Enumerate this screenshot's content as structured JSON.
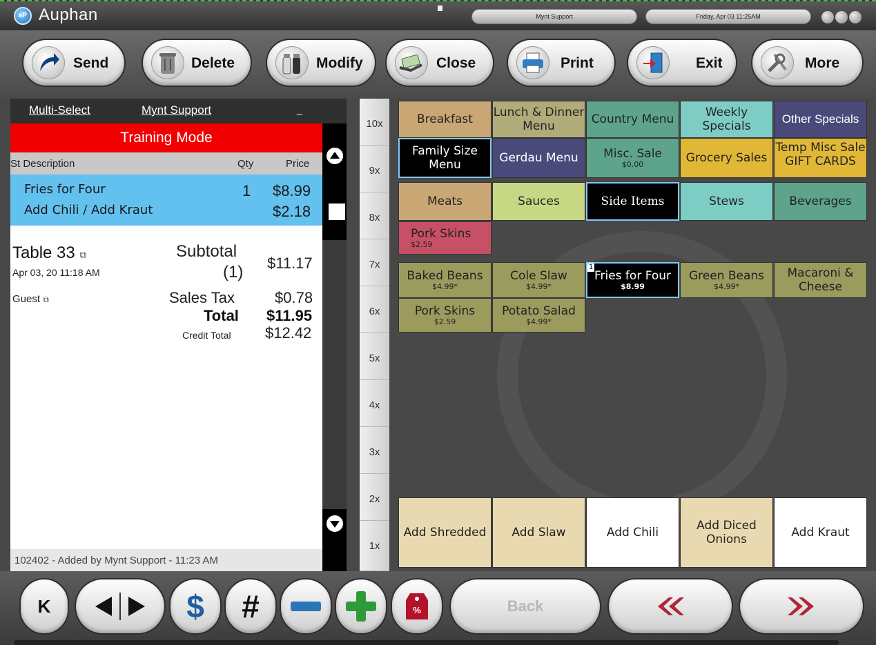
{
  "window": {
    "app_name": "Auphan",
    "user_pill": "Mynt Support",
    "date_pill": "Friday, Apr 03  11:25AM"
  },
  "toolbar": {
    "send": "Send",
    "delete": "Delete",
    "modify": "Modify",
    "close": "Close",
    "print": "Print",
    "exit": "Exit",
    "more": "More"
  },
  "order_panel": {
    "multi_select": "Multi-Select",
    "user_link": "Mynt Support",
    "dash": "_",
    "training_mode": "Training Mode",
    "columns": {
      "st_desc": "St Description",
      "qty": "Qty",
      "price": "Price"
    },
    "items": [
      {
        "description": "Fries for Four",
        "qty": "1",
        "price": "$8.99"
      },
      {
        "description": "Add Chili / Add Kraut",
        "qty": "",
        "price": "$2.18"
      }
    ],
    "table": "Table 33",
    "datetime": "Apr 03, 20 11:18 AM",
    "guest": "Guest",
    "subtotal_label": "Subtotal",
    "subtotal_count": "(1)",
    "subtotal_value": "$11.17",
    "tax_label": "Sales Tax",
    "tax_value": "$0.78",
    "total_label": "Total",
    "total_value": "$11.95",
    "credit_label": "Credit Total",
    "credit_value": "$12.42",
    "footer_note": "102402 - Added by Mynt Support - 11:23 AM"
  },
  "multipliers": [
    "10x",
    "9x",
    "8x",
    "7x",
    "6x",
    "5x",
    "4x",
    "3x",
    "2x",
    "1x"
  ],
  "categories_row1": [
    {
      "label": "Breakfast",
      "color": "#c9a774"
    },
    {
      "label": "Lunch & Dinner Menu",
      "color": "#b1ab7a"
    },
    {
      "label": "Country Menu",
      "color": "#5ea48d"
    },
    {
      "label": "Weekly Specials",
      "color": "#7dcdc5"
    },
    {
      "label": "Other Specials",
      "color": "#4a4a7a"
    }
  ],
  "categories_row2": [
    {
      "label": "Family Size Menu",
      "price": "",
      "color": "#000000"
    },
    {
      "label": "Gerdau Menu",
      "price": "",
      "color": "#4a4a7a"
    },
    {
      "label": "Misc. Sale",
      "price": "$0.00",
      "color": "#5ea48d"
    },
    {
      "label": "Grocery Sales",
      "price": "",
      "color": "#e1b736"
    },
    {
      "label": "Temp Misc Sale GIFT CARDS",
      "price": "",
      "color": "#e1b736"
    }
  ],
  "subcategories": [
    {
      "label": "Meats",
      "color": "#c9a774"
    },
    {
      "label": "Sauces",
      "color": "#c7d884"
    },
    {
      "label": "Side Items",
      "color": "#000000"
    },
    {
      "label": "Stews",
      "color": "#7dcdc5"
    },
    {
      "label": "Beverages",
      "color": "#5ea48d"
    }
  ],
  "special_item": {
    "label": "Pork Skins",
    "price": "$2.59",
    "color": "#c85066"
  },
  "items_row1": [
    {
      "label": "Baked Beans",
      "price": "$4.99*",
      "color": "#9b9b5e"
    },
    {
      "label": "Cole Slaw",
      "price": "$4.99*",
      "color": "#9b9b5e"
    },
    {
      "label": "Fries for Four",
      "price": "$8.99",
      "color": "#000000",
      "badge": "1"
    },
    {
      "label": "Green Beans",
      "price": "$4.99*",
      "color": "#9b9b5e"
    },
    {
      "label": "Macaroni & Cheese",
      "price": "",
      "color": "#9b9b5e"
    }
  ],
  "items_row2": [
    {
      "label": "Pork Skins",
      "price": "$2.59",
      "color": "#9b9b5e"
    },
    {
      "label": "Potato Salad",
      "price": "$4.99*",
      "color": "#9b9b5e"
    }
  ],
  "modifiers": [
    {
      "label": "Add Shredded",
      "color": "#e8d9b0"
    },
    {
      "label": "Add Slaw",
      "color": "#e8d9b0"
    },
    {
      "label": "Add Chili",
      "color": "#ffffff"
    },
    {
      "label": "Add Diced Onions",
      "color": "#e8d9b0"
    },
    {
      "label": "Add Kraut",
      "color": "#ffffff"
    }
  ],
  "bottom_bar": {
    "k": "K",
    "dollar": "$",
    "hash": "#",
    "back": "Back"
  }
}
